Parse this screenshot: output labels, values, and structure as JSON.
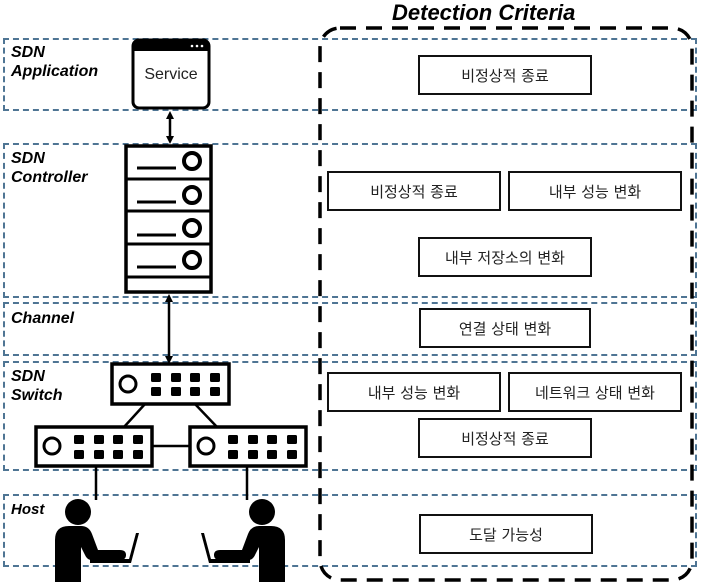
{
  "title": "Detection Criteria",
  "layers": [
    {
      "id": "application",
      "label_line1": "SDN",
      "label_line2": "Application"
    },
    {
      "id": "controller",
      "label_line1": "SDN",
      "label_line2": "Controller"
    },
    {
      "id": "channel",
      "label_line1": "Channel"
    },
    {
      "id": "switch",
      "label_line1": "SDN",
      "label_line2": "Switch"
    },
    {
      "id": "host",
      "label_line1": "Host"
    }
  ],
  "service_label": "Service",
  "criteria": {
    "application": [
      "비정상적 종료"
    ],
    "controller": [
      "비정상적 종료",
      "내부 성능 변화",
      "내부 저장소의 변화"
    ],
    "channel": [
      "연결 상태 변화"
    ],
    "switch": [
      "내부 성능 변화",
      "네트워크 상태 변화",
      "비정상적 종료"
    ],
    "host": [
      "도달 가능성"
    ]
  },
  "colors": {
    "layer_border": "#4f7594",
    "ink": "#000000"
  }
}
